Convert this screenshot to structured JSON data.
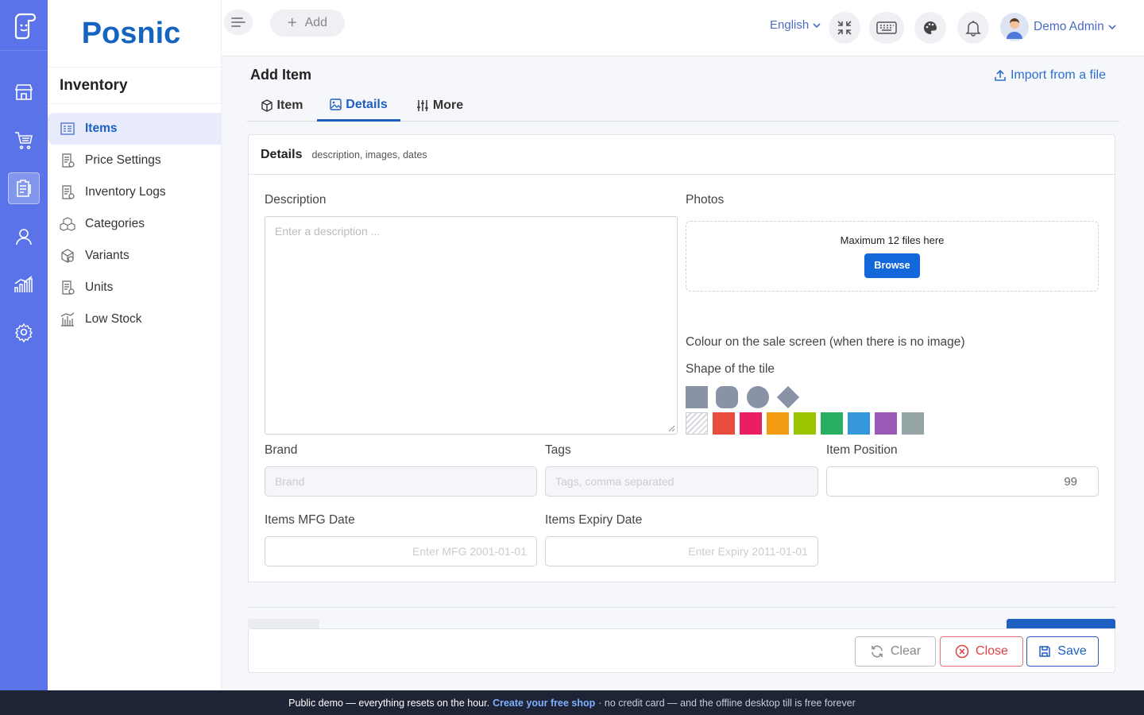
{
  "app": {
    "brand": "Posnic"
  },
  "rail": [
    "store-icon",
    "cart-icon",
    "inventory-clipboard-icon",
    "user-icon",
    "reports-chart-icon",
    "settings-gear-icon"
  ],
  "sidebar": {
    "section": "Inventory",
    "items": [
      {
        "label": "Items",
        "icon": "items-list-icon"
      },
      {
        "label": "Price Settings",
        "icon": "price-doc-icon"
      },
      {
        "label": "Inventory Logs",
        "icon": "logs-doc-icon"
      },
      {
        "label": "Categories",
        "icon": "categories-cubes-icon"
      },
      {
        "label": "Variants",
        "icon": "variants-box-icon"
      },
      {
        "label": "Units",
        "icon": "units-doc-icon"
      },
      {
        "label": "Low Stock",
        "icon": "low-stock-icon"
      }
    ]
  },
  "topbar": {
    "add_label": "Add",
    "language": "English",
    "user_name": "Demo Admin"
  },
  "page": {
    "title": "Add Item",
    "import_label": "Import from a file",
    "tabs": [
      {
        "label": "Item"
      },
      {
        "label": "Details"
      },
      {
        "label": "More"
      }
    ]
  },
  "details": {
    "title": "Details",
    "subtitle": "description, images, dates",
    "description_label": "Description",
    "description_placeholder": "Enter a description ...",
    "photos_label": "Photos",
    "photos_hint": "Maximum 12 files here",
    "browse_label": "Browse",
    "colour_label": "Colour on the sale screen (when there is no image)",
    "shape_label": "Shape of the tile",
    "colours": [
      "#e74c3c",
      "#e91e63",
      "#f39c12",
      "#9bc400",
      "#27ae60",
      "#3498db",
      "#9b59b6",
      "#95a5a6"
    ],
    "brand_label": "Brand",
    "brand_placeholder": "Brand",
    "tags_label": "Tags",
    "tags_placeholder": "Tags, comma separated",
    "position_label": "Item Position",
    "position_value": "99",
    "mfg_label": "Items MFG Date",
    "mfg_placeholder": "Enter MFG 2001-01-01",
    "expiry_label": "Items Expiry Date",
    "expiry_placeholder": "Enter Expiry 2011-01-01"
  },
  "footer": {
    "clear_label": "Clear",
    "close_label": "Close",
    "save_label": "Save"
  },
  "banner": {
    "lead": "Public demo — everything resets on the hour.",
    "link": "Create your free shop",
    "rest": "· no credit card — and the offline desktop till is free forever"
  }
}
